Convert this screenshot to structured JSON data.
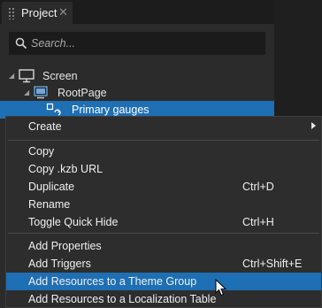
{
  "tab": {
    "label": "Project",
    "close": "✕"
  },
  "search": {
    "placeholder": "Search..."
  },
  "tree": {
    "items": [
      {
        "label": "Screen"
      },
      {
        "label": "RootPage"
      },
      {
        "label": "Primary gauges"
      }
    ]
  },
  "menu": {
    "items": [
      {
        "label": "Create",
        "shortcut": ""
      },
      {
        "label": "Copy",
        "shortcut": ""
      },
      {
        "label": "Copy .kzb URL",
        "shortcut": ""
      },
      {
        "label": "Duplicate",
        "shortcut": "Ctrl+D"
      },
      {
        "label": "Rename",
        "shortcut": ""
      },
      {
        "label": "Toggle Quick Hide",
        "shortcut": "Ctrl+H"
      },
      {
        "label": "Add Properties",
        "shortcut": ""
      },
      {
        "label": "Add Triggers",
        "shortcut": "Ctrl+Shift+E"
      },
      {
        "label": "Add Resources to a Theme Group",
        "shortcut": ""
      },
      {
        "label": "Add Resources to a Localization Table",
        "shortcut": ""
      }
    ]
  },
  "colors": {
    "selection": "#1e6fb3",
    "panel": "#2b2b2b",
    "menu": "#2d2d2d"
  },
  "icons": [
    "search-icon",
    "screen-icon",
    "page-icon",
    "node-link-icon",
    "submenu-arrow-icon",
    "mouse-cursor-icon"
  ]
}
